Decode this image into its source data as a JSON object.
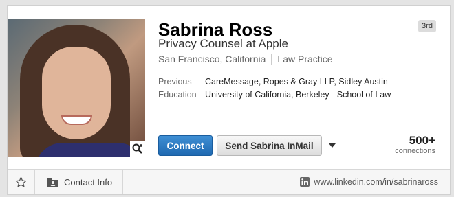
{
  "profile": {
    "name": "Sabrina Ross",
    "headline": "Privacy Counsel at Apple",
    "location": "San Francisco, California",
    "industry": "Law Practice",
    "degree": "3rd",
    "previous_label": "Previous",
    "previous_value": "CareMessage, Ropes & Gray LLP, Sidley Austin",
    "education_label": "Education",
    "education_value": "University of California, Berkeley - School of Law"
  },
  "actions": {
    "connect_label": "Connect",
    "inmail_label": "Send Sabrina InMail"
  },
  "connections": {
    "count": "500+",
    "label": "connections"
  },
  "footer": {
    "contact_info_label": "Contact Info",
    "profile_url": "www.linkedin.com/in/sabrinaross"
  },
  "icons": {
    "star": "star-icon",
    "contact": "contact-card-icon",
    "linkedin": "linkedin-icon",
    "zoom": "zoom-in-icon",
    "dropdown": "caret-down-icon"
  },
  "colors": {
    "connect_button": "#2368b0",
    "background": "#e4e4e4"
  }
}
